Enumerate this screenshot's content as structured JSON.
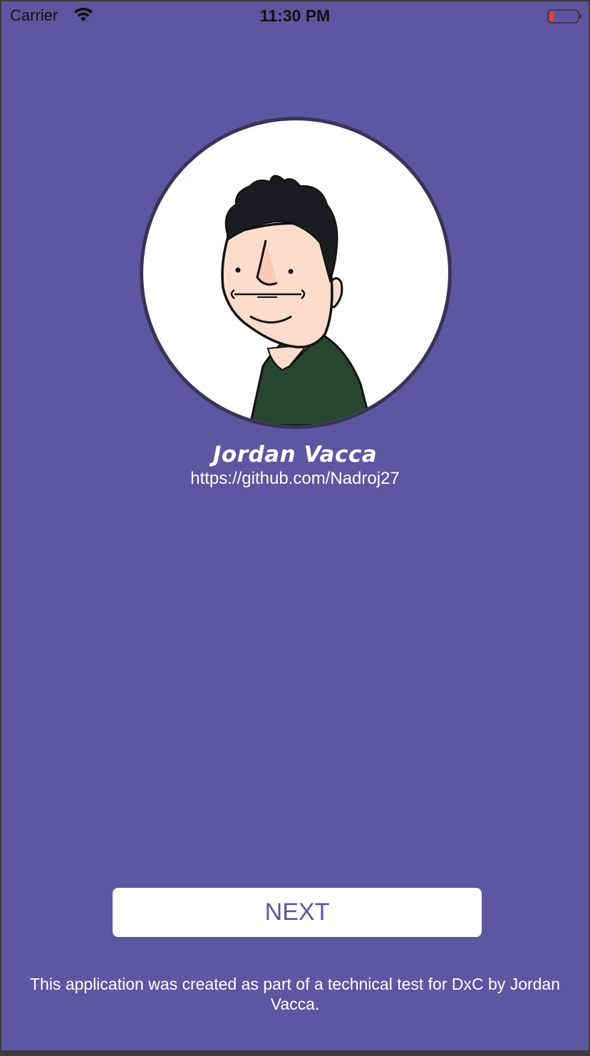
{
  "status_bar": {
    "carrier": "Carrier",
    "time": "11:30 PM",
    "wifi_icon": "wifi-icon",
    "battery_icon": "battery-low-icon"
  },
  "profile": {
    "avatar_icon": "cartoon-avatar",
    "name": "Jordan Vacca",
    "link": "https://github.com/Nadroj27"
  },
  "actions": {
    "next_label": "NEXT"
  },
  "footer": {
    "note": "This application was created as part of a technical test for DxC by Jordan Vacca."
  },
  "colors": {
    "background": "#5e56a0",
    "button_bg": "#ffffff",
    "button_text": "#5e56a0",
    "text": "#ffffff",
    "avatar_ring": "#3a3359",
    "battery_low": "#ff3b30"
  }
}
